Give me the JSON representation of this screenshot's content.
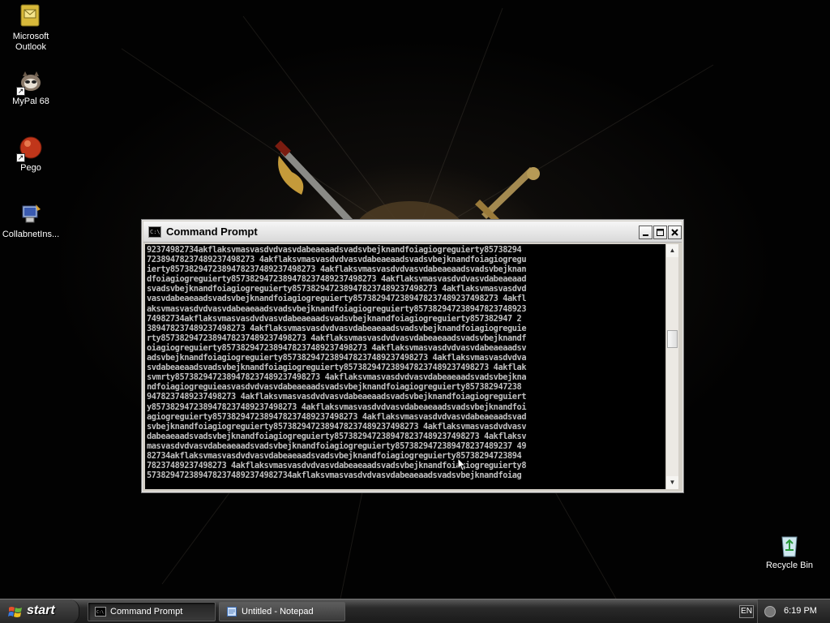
{
  "desktop": {
    "icons": [
      {
        "label": "Microsoft\nOutlook",
        "icon": "outlook-icon"
      },
      {
        "label": "MyPal 68",
        "icon": "mypal-icon"
      },
      {
        "label": "Pego",
        "icon": "pego-icon"
      },
      {
        "label": "CollabnetIns...",
        "icon": "installer-icon"
      },
      {
        "label": "Recycle Bin",
        "icon": "recycle-bin-icon"
      }
    ]
  },
  "cmd_window": {
    "title": "Command Prompt",
    "icon_text": "C:\\",
    "lines": [
      "92374982734akflaksvmasvasdvdvasvdabeaeaadsvadsvbejknandfoiagiogreguierty85738294",
      "72389478237489237498273 4akflaksvmasvasdvdvasvdabeaeaadsvadsvbejknandfoiagiogregu",
      "ierty8573829472389478237489237498273 4akflaksvmasvasdvdvasvdabeaeaadsvadsvbejknan",
      "dfoiagiogreguierty8573829472389478237489237498273 4akflaksvmasvasdvdvasvdabeaeaad",
      "svadsvbejknandfoiagiogreguierty8573829472389478237489237498273 4akflaksvmasvasdvd",
      "vasvdabeaeaadsvadsvbejknandfoiagiogreguierty8573829472389478237489237498273 4akfl",
      "aksvmasvasdvdvasvdabeaeaadsvadsvbejknandfoiagiogreguierty857382947238947823748923",
      "74982734akflaksvmasvasdvdvasvdabeaeaadsvadsvbejknandfoiagiogreguierty857382947 2",
      "389478237489237498273 4akflaksvmasvasdvdvasvdabeaeaadsvadsvbejknandfoiagiogreguie",
      "rty8573829472389478237489237498273 4akflaksvmasvasdvdvasvdabeaeaadsvadsvbejknandf",
      "oiagiogreguierty8573829472389478237489237498273 4akflaksvmasvasdvdvasvdabeaeaadsv",
      "adsvbejknandfoiagiogreguierty8573829472389478237489237498273 4akflaksvmasvasdvdva",
      "svdabeaeaadsvadsvbejknandfoiagiogreguierty8573829472389478237489237498273 4akflak",
      "svmrty8573829472389478237489237498273 4akflaksvmasvasdvdvasvdabeaeaadsvadsvbejkna",
      "ndfoiagiogreguieasvasdvdvasvdabeaeaadsvadsvbejknandfoiagiogreguierty857382947238",
      "9478237489237498273 4akflaksvmasvasdvdvasvdabeaeaadsvadsvbejknandfoiagiogreguiert",
      "y8573829472389478237489237498273 4akflaksvmasvasdvdvasvdabeaeaadsvadsvbejknandfoi",
      "agiogreguierty8573829472389478237489237498273 4akflaksvmasvasdvdvasvdabeaeaadsvad",
      "svbejknandfoiagiogreguierty8573829472389478237489237498273 4akflaksvmasvasdvdvasv",
      "dabeaeaadsvadsvbejknandfoiagiogreguierty8573829472389478237489237498273 4akflaksv",
      "masvasdvdvasvdabeaeaadsvadsvbejknandfoiagiogreguierty8573829472389478237489237 49",
      "82734akflaksvmasvasdvdvasvdabeaeaadsvadsvbejknandfoiagiogreguierty85738294723894",
      "78237489237498273 4akflaksvmasvasdvdvasvdabeaeaadsvadsvbejknandfoiagiogreguierty8",
      "5738294723894782374892374982734akflaksvmasvasdvdvasvdabeaeaadsvadsvbejknandfoiag"
    ]
  },
  "taskbar": {
    "start_label": "start",
    "tasks": [
      {
        "label": "Command Prompt",
        "active": true
      },
      {
        "label": "Untitled - Notepad",
        "active": false
      }
    ],
    "language": "EN",
    "clock": "6:19 PM"
  }
}
